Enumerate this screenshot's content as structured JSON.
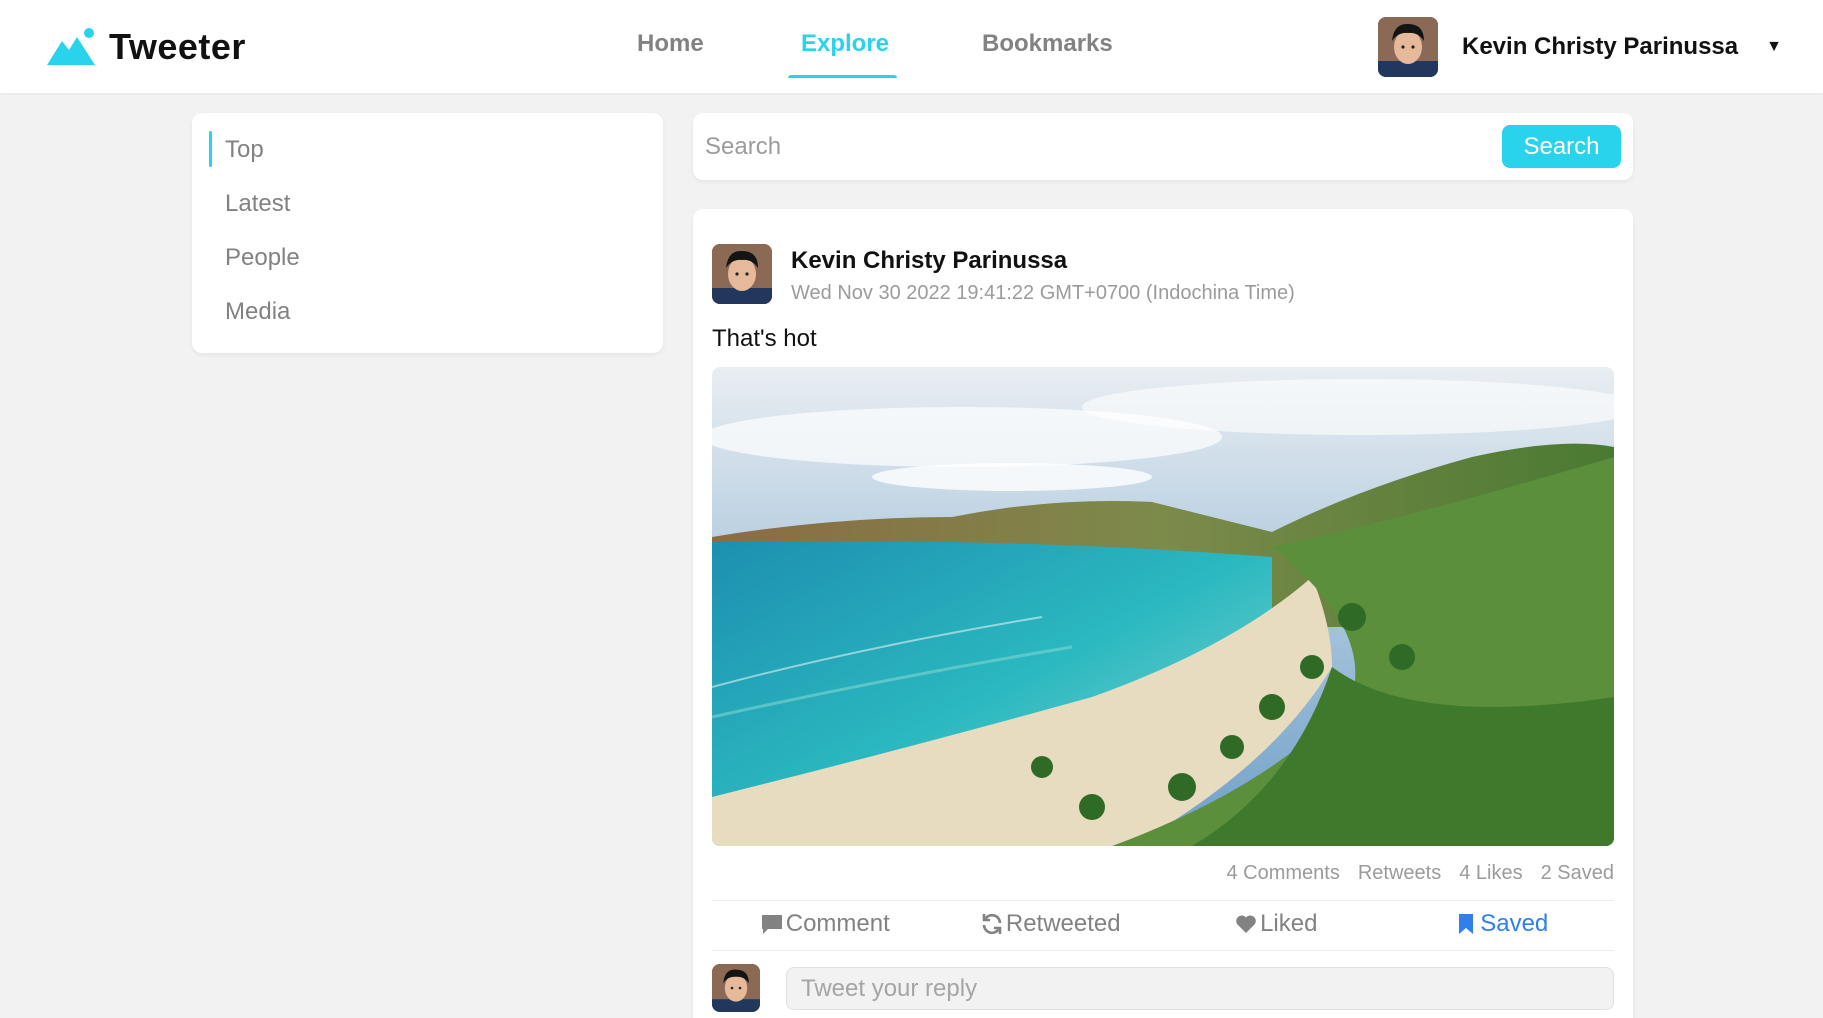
{
  "app": {
    "name": "Tweeter",
    "accent_color": "#2ad3ec"
  },
  "nav": {
    "items": [
      {
        "label": "Home",
        "active": false
      },
      {
        "label": "Explore",
        "active": true
      },
      {
        "label": "Bookmarks",
        "active": false
      }
    ]
  },
  "user": {
    "name": "Kevin Christy Parinussa",
    "menu_icon": "caret-down-icon"
  },
  "filters": {
    "items": [
      {
        "label": "Top",
        "active": true
      },
      {
        "label": "Latest",
        "active": false
      },
      {
        "label": "People",
        "active": false
      },
      {
        "label": "Media",
        "active": false
      }
    ]
  },
  "search": {
    "placeholder": "Search",
    "value": "",
    "button_label": "Search"
  },
  "tweet": {
    "author": "Kevin Christy Parinussa",
    "timestamp": "Wed Nov 30 2022 19:41:22 GMT+0700 (Indochina Time)",
    "text": "That's hot",
    "image_subject": "beach-bay-photo",
    "stats": {
      "comments": "4 Comments",
      "retweets": "Retweets",
      "likes": "4 Likes",
      "saved": "2 Saved"
    },
    "actions": {
      "comment": "Comment",
      "retweet": "Retweeted",
      "like": "Liked",
      "save": "Saved"
    },
    "saved_color": "#2f80ed",
    "reply_placeholder": "Tweet your reply"
  }
}
